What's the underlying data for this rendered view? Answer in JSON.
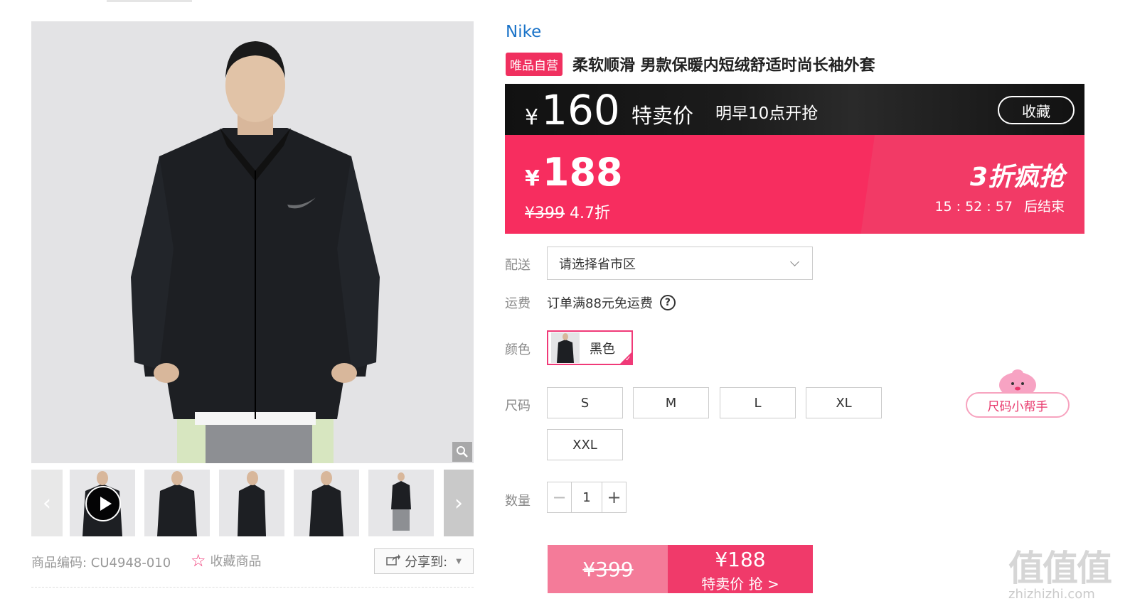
{
  "product": {
    "brand": "Nike",
    "self_badge": "唯品自营",
    "title": "柔软顺滑 男款保暖内短绒舒适时尚长袖外套",
    "sku_label": "商品编码: CU4948-010",
    "favorite_label": "收藏商品",
    "share_label": "分享到:"
  },
  "flash_sale": {
    "currency": "¥",
    "price": "160",
    "label": "特卖价",
    "time": "明早10点开抢",
    "collect": "收藏"
  },
  "deal": {
    "currency": "¥",
    "price": "188",
    "original": "¥399",
    "discount": "4.7折",
    "promo": "3折疯抢",
    "countdown": "15 : 52 : 57",
    "countdown_suffix": "后结束"
  },
  "options": {
    "delivery_label": "配送",
    "delivery_placeholder": "请选择省市区",
    "freight_label": "运费",
    "freight_text": "订单满88元免运费",
    "color_label": "颜色",
    "color_value": "黑色",
    "size_label": "尺码",
    "sizes": [
      "S",
      "M",
      "L",
      "XL",
      "XXL"
    ],
    "size_helper": "尺码小帮手",
    "qty_label": "数量",
    "qty_value": "1"
  },
  "buy": {
    "original": "¥399",
    "price": "¥188",
    "label": "特卖价 抢 >"
  },
  "watermark": {
    "big": "值值值",
    "small": "zhizhizhi.com"
  },
  "colors": {
    "accent": "#f72d5f",
    "brand_link": "#1a73c8",
    "flash_bg": "#111111"
  }
}
